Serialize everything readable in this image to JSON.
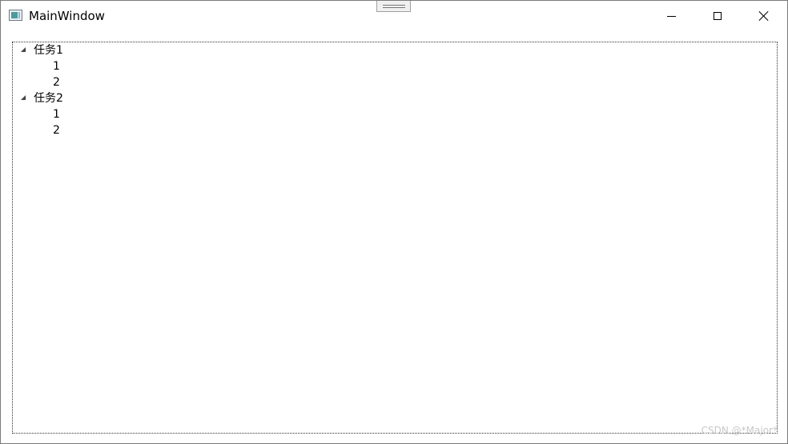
{
  "window": {
    "title": "MainWindow",
    "icon": "window-app-icon",
    "controls": {
      "minimize": "minimize-icon",
      "maximize": "maximize-icon",
      "close": "close-icon"
    }
  },
  "tree": {
    "nodes": [
      {
        "label": "任务1",
        "expanded": true,
        "children": [
          {
            "label": "1"
          },
          {
            "label": "2"
          }
        ]
      },
      {
        "label": "任务2",
        "expanded": true,
        "children": [
          {
            "label": "1"
          },
          {
            "label": "2"
          }
        ]
      }
    ]
  },
  "watermark": "CSDN @*Major*"
}
